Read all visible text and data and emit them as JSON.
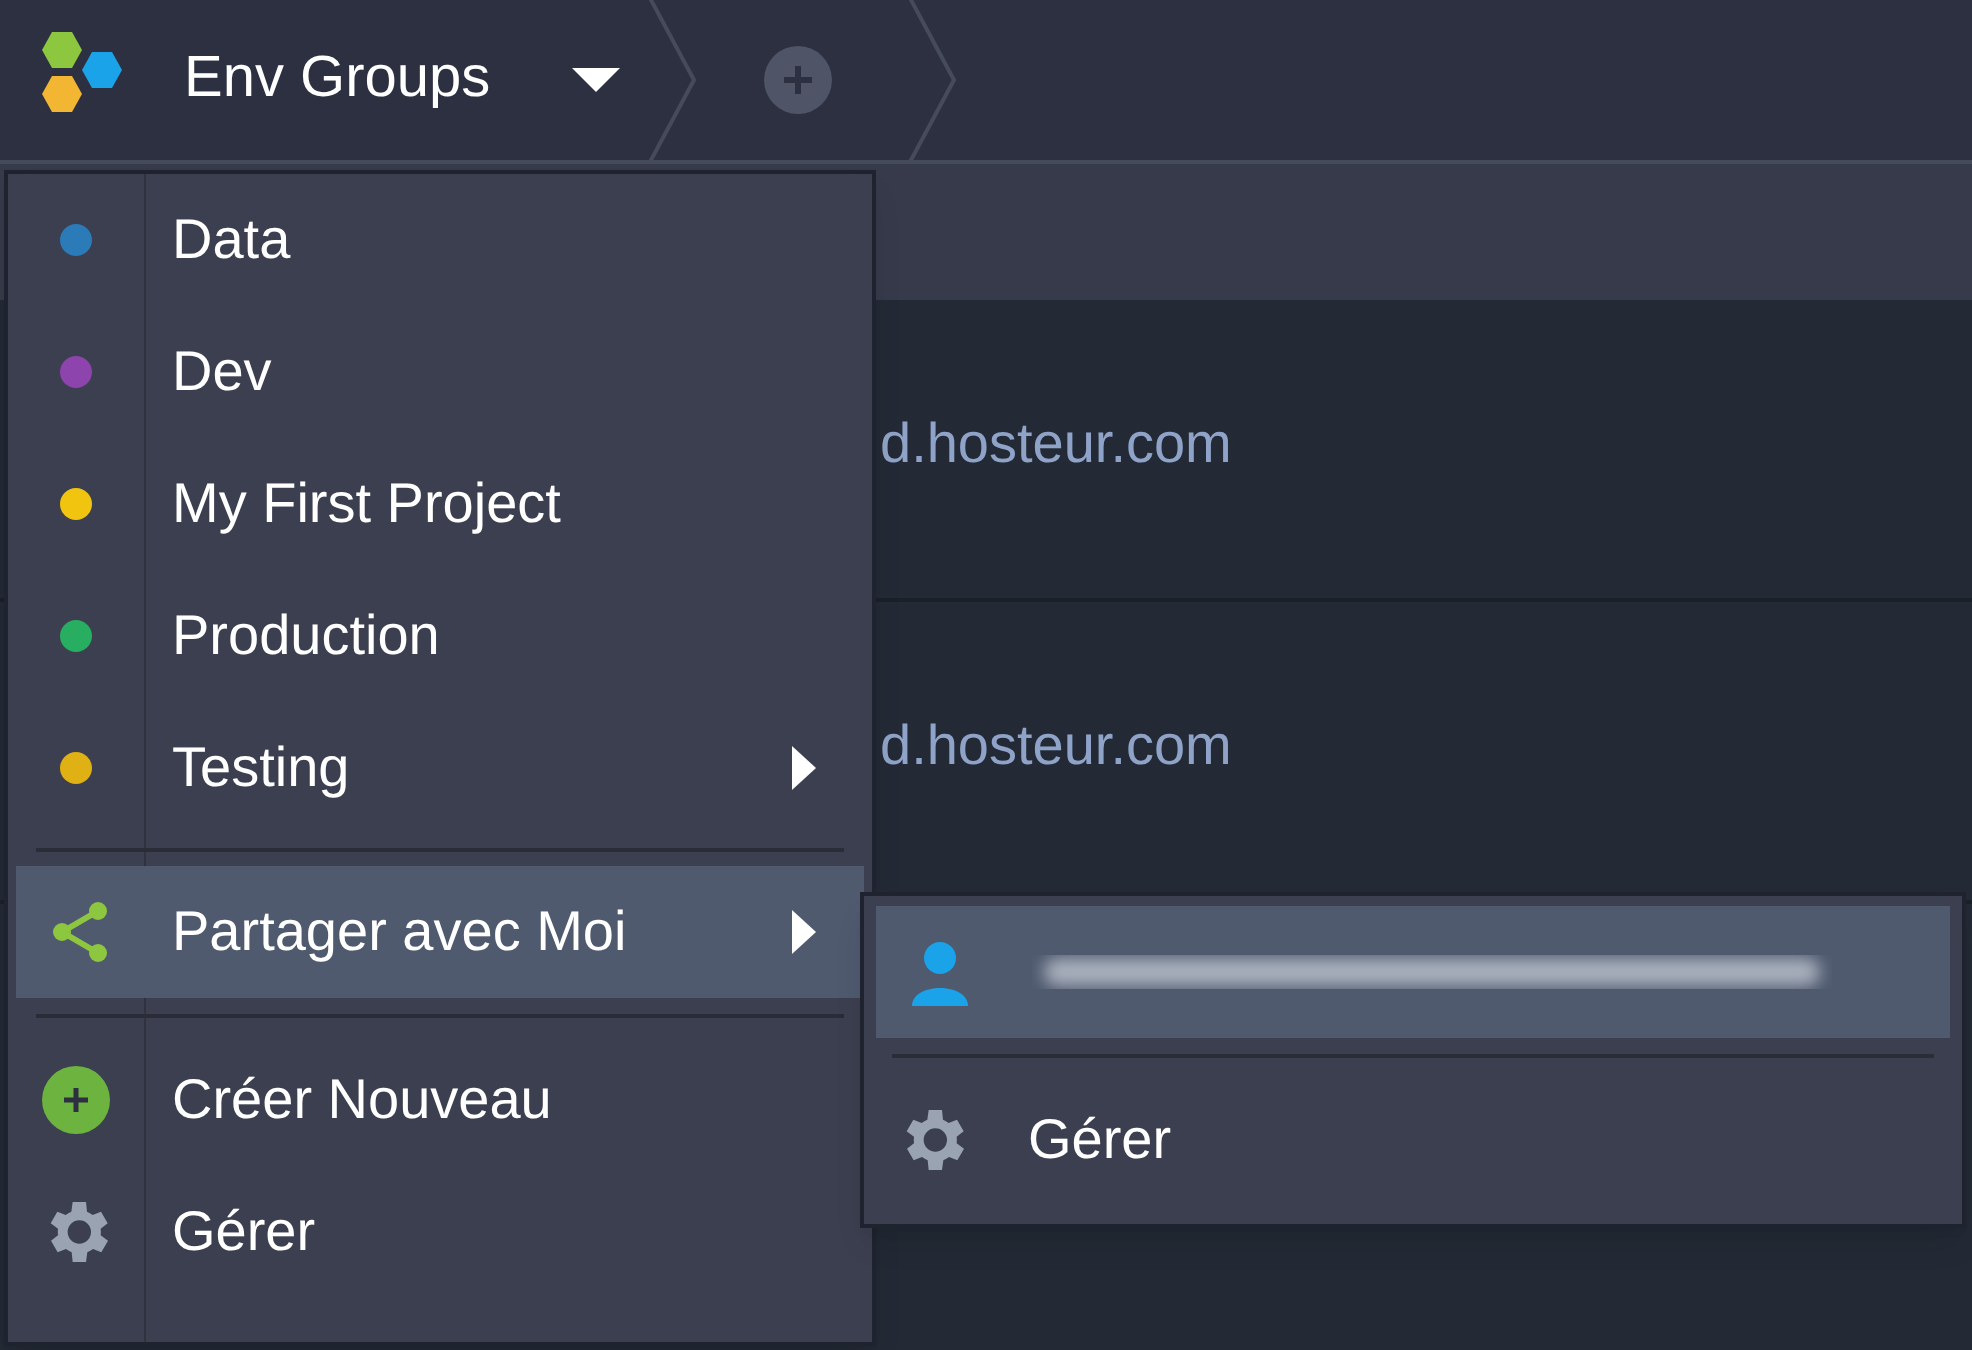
{
  "header": {
    "title": "Env Groups"
  },
  "background_rows": [
    {
      "domain": "d.hosteur.com"
    },
    {
      "domain": "d.hosteur.com"
    }
  ],
  "menu": {
    "groups": [
      {
        "label": "Data",
        "color": "#2b7bb9",
        "has_submenu": false
      },
      {
        "label": "Dev",
        "color": "#8e44ad",
        "has_submenu": false
      },
      {
        "label": "My First Project",
        "color": "#f1c40f",
        "has_submenu": false
      },
      {
        "label": "Production",
        "color": "#27ae60",
        "has_submenu": false
      },
      {
        "label": "Testing",
        "color": "#e0b114",
        "has_submenu": true
      }
    ],
    "shared": {
      "label": "Partager avec Moi",
      "selected": true
    },
    "actions": [
      {
        "kind": "create",
        "label": "Créer Nouveau"
      },
      {
        "kind": "manage",
        "label": "Gérer"
      }
    ]
  },
  "submenu": {
    "manage_label": "Gérer"
  }
}
